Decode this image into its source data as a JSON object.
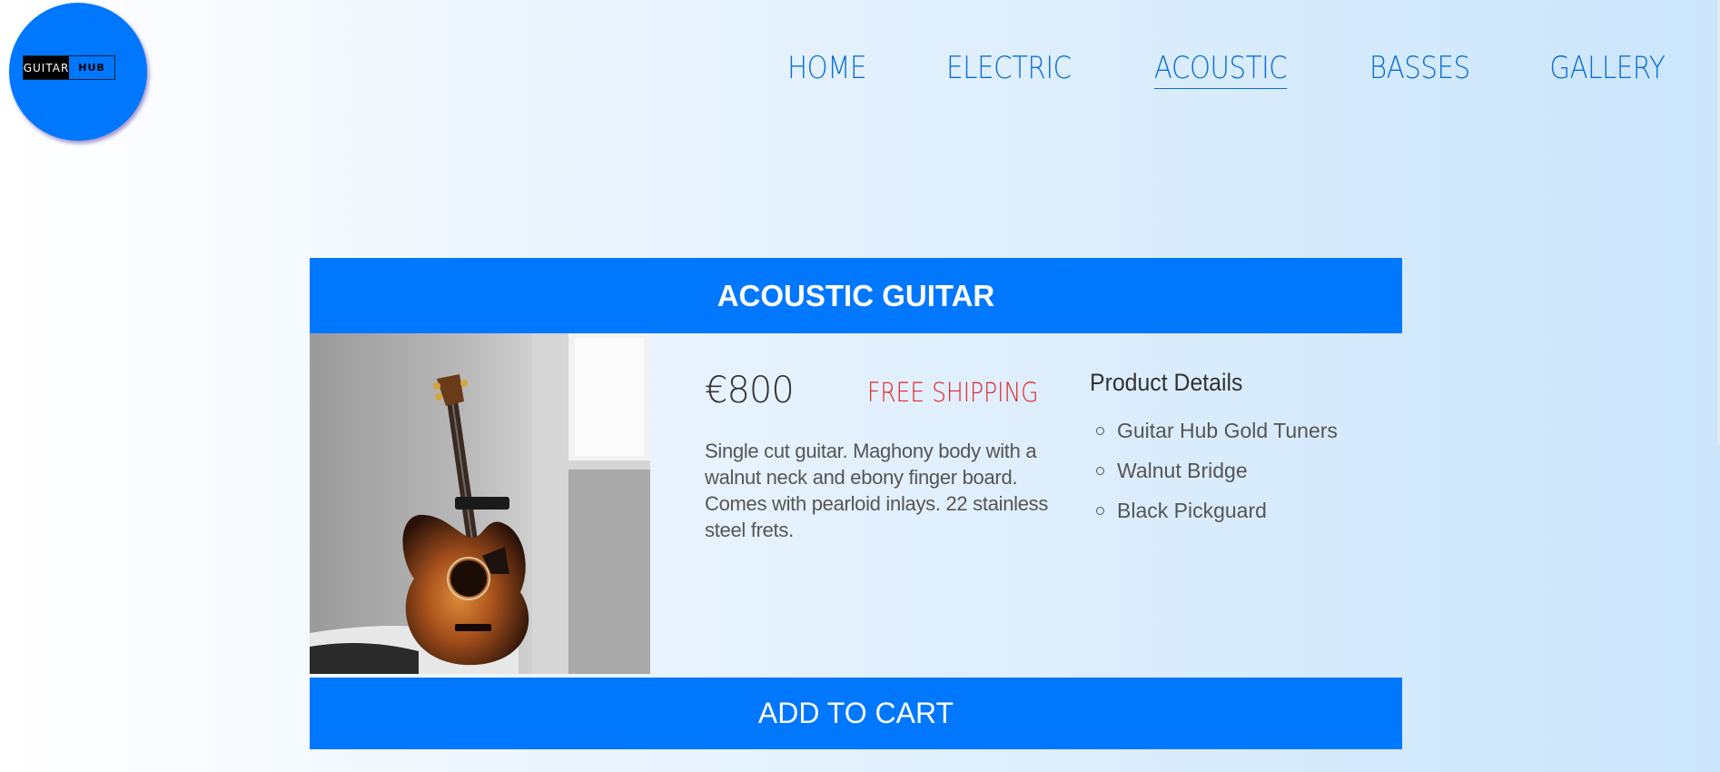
{
  "logo": {
    "text_left": "GUITAR",
    "text_right": "HUB"
  },
  "nav": {
    "items": [
      {
        "label": "HOME"
      },
      {
        "label": "ELECTRIC"
      },
      {
        "label": "ACOUSTIC",
        "active": true
      },
      {
        "label": "BASSES"
      },
      {
        "label": "GALLERY"
      }
    ]
  },
  "product": {
    "title": "ACOUSTIC GUITAR",
    "price": "€800",
    "shipping": "FREE SHIPPING",
    "description": "Single cut guitar. Maghony body with a walnut neck and ebony finger board. Comes with pearloid inlays. 22 stainless steel frets.",
    "details_title": "Product Details",
    "details": [
      "Guitar Hub Gold Tuners",
      "Walnut Bridge",
      "Black Pickguard"
    ],
    "cart_label": "ADD TO CART"
  },
  "colors": {
    "accent": "#0077ff",
    "nav_text": "#0a6fd8",
    "shipping": "#e0262c"
  }
}
